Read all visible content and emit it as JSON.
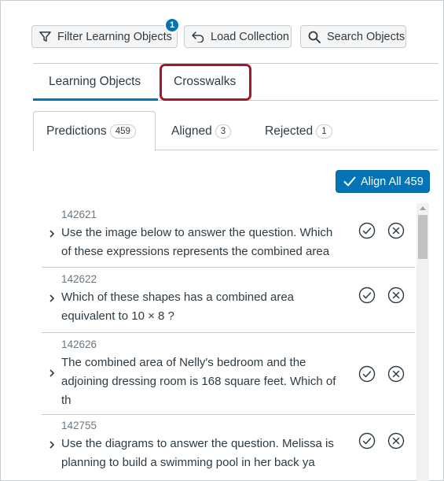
{
  "toolbar": {
    "filter_label": "Filter Learning Objects",
    "filter_badge": "1",
    "load_label": "Load Collection",
    "search_label": "Search Objects"
  },
  "top_tabs": [
    {
      "label": "Learning Objects",
      "active": true
    },
    {
      "label": "Crosswalks",
      "active": false,
      "highlighted": true
    }
  ],
  "sub_tabs": [
    {
      "label": "Predictions",
      "count": "459",
      "active": true
    },
    {
      "label": "Aligned",
      "count": "3",
      "active": false
    },
    {
      "label": "Rejected",
      "count": "1",
      "active": false
    }
  ],
  "align_all_label": "Align All 459",
  "items": [
    {
      "id": "142621",
      "lines": [
        "Use the image below to answer the question. Which",
        "of these expressions represents the combined area"
      ]
    },
    {
      "id": "142622",
      "lines": [
        "Which of these shapes has a combined area",
        "equivalent to 10 × 8 ?"
      ]
    },
    {
      "id": "142626",
      "lines": [
        "The combined area of Nelly's bedroom and the",
        "adjoining dressing room is 168 square feet. Which of",
        "th"
      ]
    },
    {
      "id": "142755",
      "lines": [
        "Use the diagrams to answer the question. Melissa is",
        "planning to build a swimming pool in her back ya"
      ]
    }
  ],
  "colors": {
    "accent": "#0374b5",
    "highlight": "#a3192a",
    "text": "#2d3b45",
    "muted": "#6b7780",
    "border": "#c7cdd1"
  },
  "icons": {
    "filter": "filter-icon",
    "load": "undo-arrow-icon",
    "search": "search-icon",
    "check": "checkmark-icon",
    "expand": "chevron-right-icon",
    "approve": "check-circle-icon",
    "reject": "x-circle-icon"
  }
}
